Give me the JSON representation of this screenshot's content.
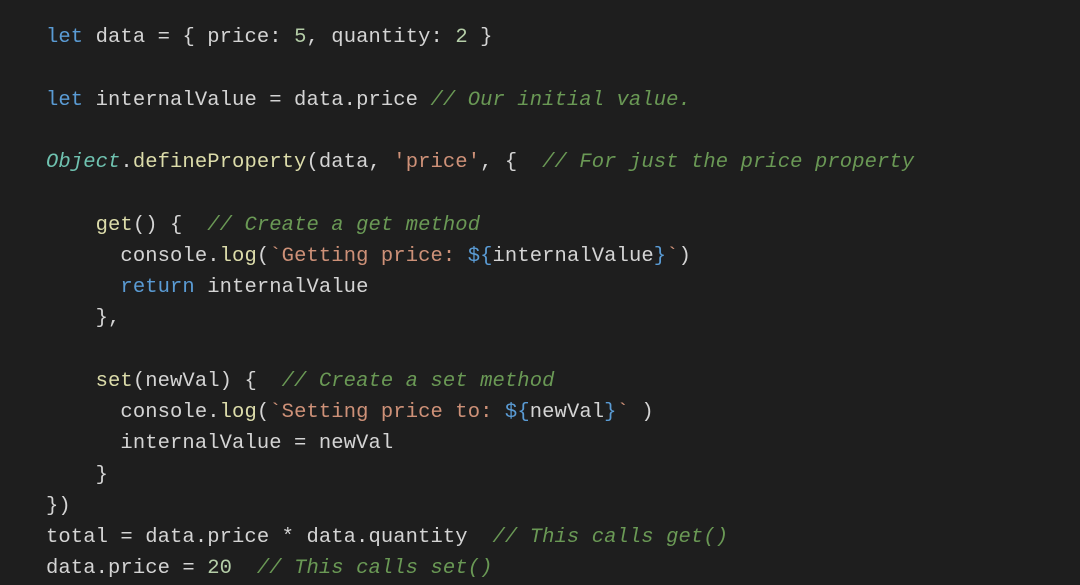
{
  "code": {
    "l1_let": "let",
    "l1_data": "data",
    "l1_eq": " = { ",
    "l1_price_key": "price",
    "l1_colon1": ": ",
    "l1_five": "5",
    "l1_comma": ", ",
    "l1_qty_key": "quantity",
    "l1_colon2": ": ",
    "l1_two": "2",
    "l1_close": " }",
    "l3_let": "let",
    "l3_iv": " internalValue = data.price ",
    "l3_cmt": "// Our initial value.",
    "l5_obj": "Object",
    "l5_dot": ".",
    "l5_def": "defineProperty",
    "l5_open": "(data, ",
    "l5_str": "'price'",
    "l5_after": ", {  ",
    "l5_cmt": "// For just the price property",
    "l7_indent": "    ",
    "l7_get": "get",
    "l7_paren": "() {  ",
    "l7_cmt": "// Create a get method",
    "l8_indent": "      ",
    "l8_console": "console",
    "l8_dot": ".",
    "l8_log": "log",
    "l8_open": "(",
    "l8_str1": "`Getting price: ",
    "l8_tpl_open": "${",
    "l8_iv": "internalValue",
    "l8_tpl_close": "}",
    "l8_str2": "`",
    "l8_close": ")",
    "l9_indent": "      ",
    "l9_return": "return",
    "l9_iv": " internalValue",
    "l10_indent": "    ",
    "l10_close": "},",
    "l12_indent": "    ",
    "l12_set": "set",
    "l12_paren": "(newVal) {  ",
    "l12_cmt": "// Create a set method",
    "l13_indent": "      ",
    "l13_console": "console",
    "l13_dot": ".",
    "l13_log": "log",
    "l13_open": "(",
    "l13_str1": "`Setting price to: ",
    "l13_tpl_open": "${",
    "l13_nv": "newVal",
    "l13_tpl_close": "}",
    "l13_str2": "`",
    "l13_close": " )",
    "l14_indent": "      ",
    "l14_assign": "internalValue = newVal",
    "l15_indent": "    ",
    "l15_close": "}",
    "l16_close": "})",
    "l17_total": "total = data.price * data.quantity  ",
    "l17_cmt": "// This calls get()",
    "l18_assign": "data.price = ",
    "l18_twenty": "20",
    "l18_sp": "  ",
    "l18_cmt": "// This calls set()"
  }
}
